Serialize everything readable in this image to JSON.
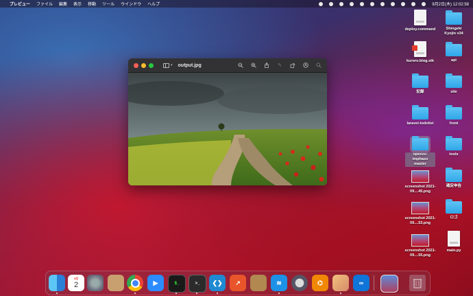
{
  "menubar": {
    "app_name": "プレビュー",
    "menus": [
      "ファイル",
      "編集",
      "表示",
      "移動",
      "ツール",
      "ウインドウ",
      "ヘルプ"
    ],
    "clock": "9月2日(木) 12:02:58"
  },
  "window": {
    "title": "output.jpg",
    "toolbar_icons": [
      "zoom-out-icon",
      "zoom-in-icon",
      "share-icon",
      "markup-icon",
      "rotate-icon",
      "annotate-icon",
      "search-icon"
    ]
  },
  "desktop": {
    "items": [
      {
        "label": "deploy.command",
        "kind": "doc"
      },
      {
        "label": "Shingeki Kyojin v34",
        "kind": "folder"
      },
      {
        "label": "kuroro.blog.stk",
        "kind": "doc-red"
      },
      {
        "label": "api",
        "kind": "folder"
      },
      {
        "label": "記録",
        "kind": "folder"
      },
      {
        "label": "site",
        "kind": "folder"
      },
      {
        "label": "laravel-todolist",
        "kind": "folder"
      },
      {
        "label": "front",
        "kind": "folder"
      },
      {
        "label": "openzx-imphaso master",
        "kind": "folder-selected"
      },
      {
        "label": "tools",
        "kind": "folder"
      },
      {
        "label": "screenshot 2021-09....45.png",
        "kind": "thumb"
      },
      {
        "label": "確定申告",
        "kind": "folder"
      },
      {
        "label": "screenshot 2021-09....53.png",
        "kind": "thumb"
      },
      {
        "label": "ロゴ",
        "kind": "folder"
      },
      {
        "label": "screenshot 2021-09....55.png",
        "kind": "thumb"
      },
      {
        "label": "main.py",
        "kind": "doc"
      }
    ]
  },
  "dock": {
    "calendar_month": "9月",
    "calendar_day": "2",
    "apps": [
      "finder-icon",
      "calendar-icon",
      "system-preferences-icon",
      "contacts-icon",
      "chrome-icon",
      "zoom-icon",
      "terminal-icon",
      "terminal-icon",
      "vscode-icon",
      "activity-icon",
      "archive-icon",
      "docker-icon",
      "quicktime-icon",
      "drawio-icon",
      "preview-icon",
      "infinity-icon",
      "screenshot-icon",
      "trash-icon"
    ]
  },
  "colors": {
    "accent": "#2fa6e8",
    "close": "#ff5f57",
    "minimize": "#febc2e",
    "maximize": "#28c840"
  }
}
